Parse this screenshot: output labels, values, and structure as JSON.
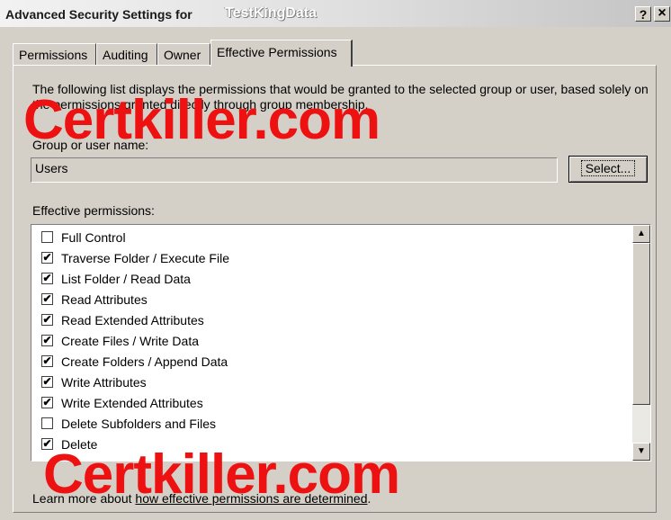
{
  "window": {
    "title_prefix": "Advanced Security Settings for",
    "title_object": "TestKingData",
    "help_button": "?",
    "close_button": "×"
  },
  "tabs": [
    {
      "label": "Permissions"
    },
    {
      "label": "Auditing"
    },
    {
      "label": "Owner"
    },
    {
      "label": "Effective Permissions",
      "active": true
    }
  ],
  "description": "The following list displays the permissions that would be granted to the selected group or user, based solely on the permissions granted directly through group membership.",
  "group": {
    "label": "Group or user name:",
    "value": "Users",
    "select_button": "Select..."
  },
  "effective": {
    "label": "Effective permissions:",
    "items": [
      {
        "label": "Full Control",
        "checked": false,
        "mark": ""
      },
      {
        "label": "Traverse Folder / Execute File",
        "checked": true,
        "mark": "✔"
      },
      {
        "label": "List Folder / Read Data",
        "checked": true,
        "mark": "✔"
      },
      {
        "label": "Read Attributes",
        "checked": true,
        "mark": "✔"
      },
      {
        "label": "Read Extended Attributes",
        "checked": true,
        "mark": "✔"
      },
      {
        "label": "Create Files / Write Data",
        "checked": true,
        "mark": "✔"
      },
      {
        "label": "Create Folders / Append Data",
        "checked": true,
        "mark": "✔"
      },
      {
        "label": "Write Attributes",
        "checked": true,
        "mark": "✔"
      },
      {
        "label": "Write Extended Attributes",
        "checked": true,
        "mark": "✔"
      },
      {
        "label": "Delete Subfolders and Files",
        "checked": false,
        "mark": ""
      },
      {
        "label": "Delete",
        "checked": true,
        "mark": "✔"
      }
    ]
  },
  "footer": {
    "prefix": "Learn more about ",
    "link": "how effective permissions are determined",
    "suffix": "."
  },
  "watermarks": [
    "Certkiller.com",
    "Certkiller.com"
  ],
  "colors": {
    "watermark": "#ee1111",
    "dialog": "#d4d0c8"
  }
}
